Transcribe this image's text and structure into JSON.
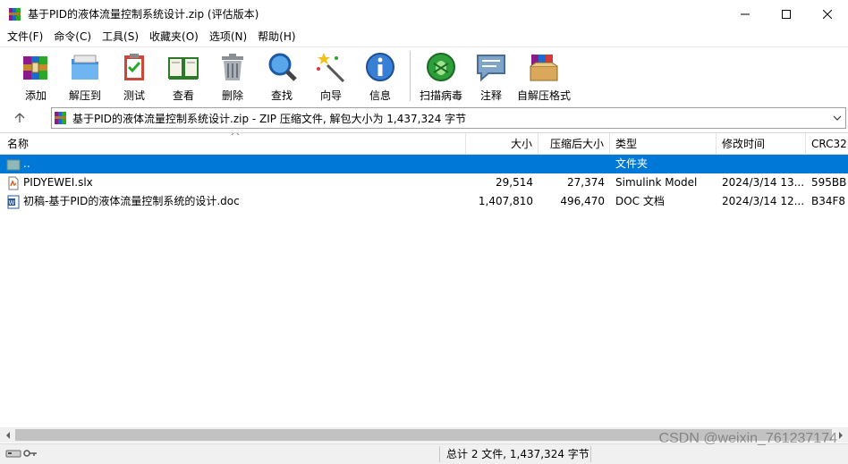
{
  "window": {
    "title": "基于PID的液体流量控制系统设计.zip (评估版本)",
    "icon": "winrar-archive-icon"
  },
  "menu": [
    "文件(F)",
    "命令(C)",
    "工具(S)",
    "收藏夹(O)",
    "选项(N)",
    "帮助(H)"
  ],
  "toolbar": {
    "buttons": [
      {
        "label": "添加",
        "icon": "add-icon"
      },
      {
        "label": "解压到",
        "icon": "extract-folder-icon"
      },
      {
        "label": "测试",
        "icon": "test-clipboard-icon"
      },
      {
        "label": "查看",
        "icon": "view-book-icon"
      },
      {
        "label": "删除",
        "icon": "trash-icon"
      },
      {
        "label": "查找",
        "icon": "magnifier-icon"
      },
      {
        "label": "向导",
        "icon": "wizard-wand-icon"
      },
      {
        "label": "信息",
        "icon": "info-icon"
      },
      {
        "label": "扫描病毒",
        "icon": "virus-scan-icon"
      },
      {
        "label": "注释",
        "icon": "comment-icon"
      },
      {
        "label": "自解压格式",
        "icon": "sfx-box-icon"
      }
    ]
  },
  "address": {
    "text": "基于PID的液体流量控制系统设计.zip - ZIP 压缩文件, 解包大小为 1,437,324 字节"
  },
  "columns": {
    "name": "名称",
    "size": "大小",
    "packed": "压缩后大小",
    "type": "类型",
    "modified": "修改时间",
    "crc": "CRC32"
  },
  "rows": [
    {
      "name": "..",
      "size": "",
      "packed": "",
      "type": "文件夹",
      "modified": "",
      "crc": "",
      "icon": "parent-folder-icon",
      "selected": true
    },
    {
      "name": "PIDYEWEI.slx",
      "size": "29,514",
      "packed": "27,374",
      "type": "Simulink Model",
      "modified": "2024/3/14 13...",
      "crc": "595BB",
      "icon": "slx-file-icon",
      "selected": false
    },
    {
      "name": "初稿-基于PID的液体流量控制系统的设计.doc",
      "size": "1,407,810",
      "packed": "496,470",
      "type": "DOC 文档",
      "modified": "2024/3/14 12...",
      "crc": "B34F8",
      "icon": "word-doc-icon",
      "selected": false
    }
  ],
  "status": {
    "text": "总计 2 文件, 1,437,324 字节"
  },
  "watermark": "CSDN @weixin_761237174",
  "colors": {
    "selection": "#0078d7",
    "status_bg": "#f0f0f0"
  }
}
